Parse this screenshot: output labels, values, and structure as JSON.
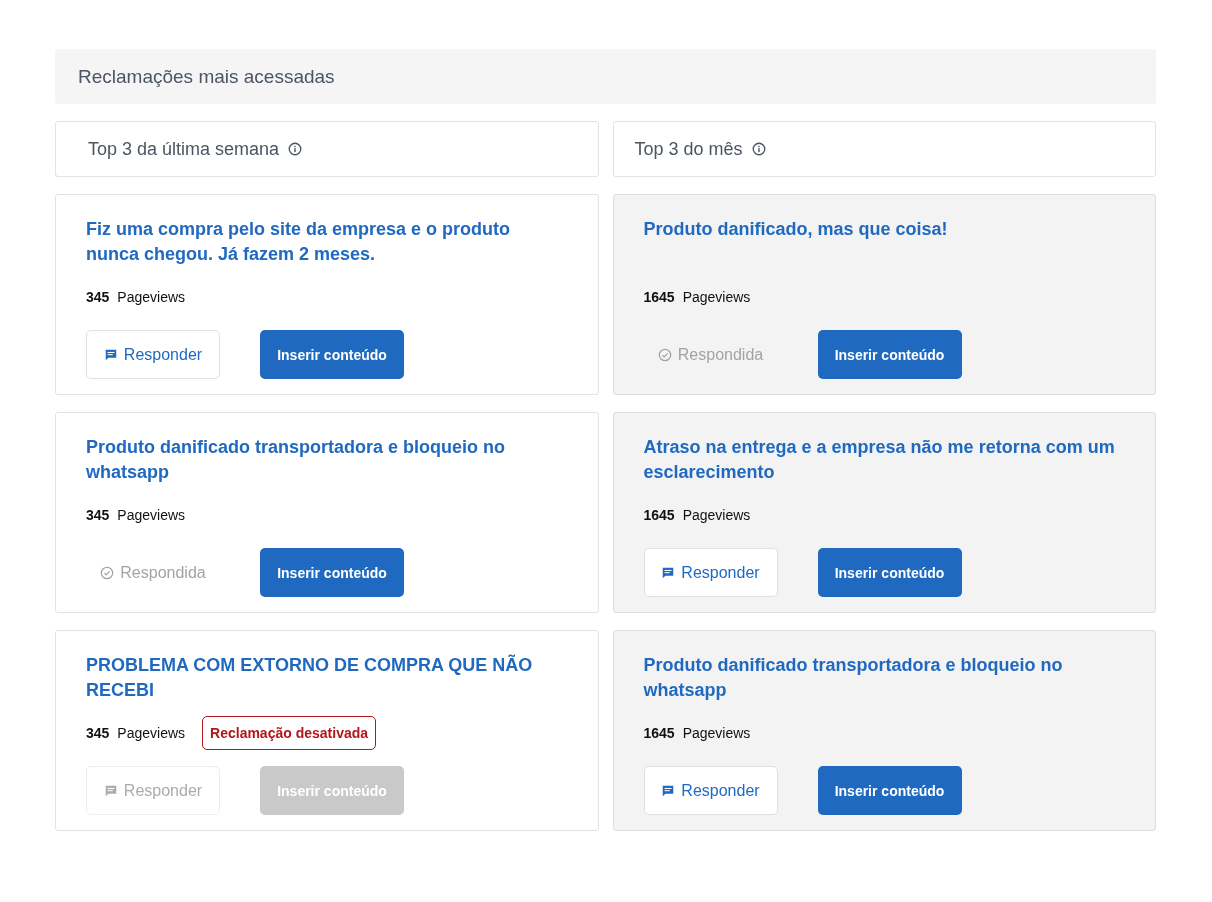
{
  "section": {
    "title": "Reclamações mais acessadas"
  },
  "columns": [
    {
      "heading": "Top 3 da última semana",
      "shaded": false,
      "cards": [
        {
          "title": "Fiz uma compra pelo site da empresa e o produto nunca chegou. Já fazem 2 meses.",
          "views": "345",
          "views_label": "Pageviews",
          "answer": {
            "kind": "reply",
            "label": "Responder",
            "disabled": false
          },
          "insert": {
            "label": "Inserir conteúdo",
            "disabled": false
          }
        },
        {
          "title": "Produto danificado transportadora e bloqueio no whatsapp",
          "views": "345",
          "views_label": "Pageviews",
          "answer": {
            "kind": "answered",
            "label": "Respondida",
            "disabled": false
          },
          "insert": {
            "label": "Inserir conteúdo",
            "disabled": false
          }
        },
        {
          "title": "PROBLEMA COM EXTORNO DE COMPRA QUE NÃO RECEBI",
          "views": "345",
          "views_label": "Pageviews",
          "badge": "Reclamação desativada",
          "answer": {
            "kind": "reply",
            "label": "Responder",
            "disabled": true
          },
          "insert": {
            "label": "Inserir conteúdo",
            "disabled": true
          }
        }
      ]
    },
    {
      "heading": "Top 3 do mês",
      "shaded": true,
      "cards": [
        {
          "title": "Produto danificado, mas que coisa!",
          "views": "1645",
          "views_label": "Pageviews",
          "answer": {
            "kind": "answered",
            "label": "Respondida",
            "disabled": false
          },
          "insert": {
            "label": "Inserir conteúdo",
            "disabled": false
          }
        },
        {
          "title": "Atraso na entrega e a empresa não me retorna com um esclarecimento",
          "views": "1645",
          "views_label": "Pageviews",
          "answer": {
            "kind": "reply",
            "label": "Responder",
            "disabled": false
          },
          "insert": {
            "label": "Inserir conteúdo",
            "disabled": false
          }
        },
        {
          "title": "Produto danificado transportadora e bloqueio no whatsapp",
          "views": "1645",
          "views_label": "Pageviews",
          "answer": {
            "kind": "reply",
            "label": "Responder",
            "disabled": false
          },
          "insert": {
            "label": "Inserir conteúdo",
            "disabled": false
          }
        }
      ]
    }
  ]
}
